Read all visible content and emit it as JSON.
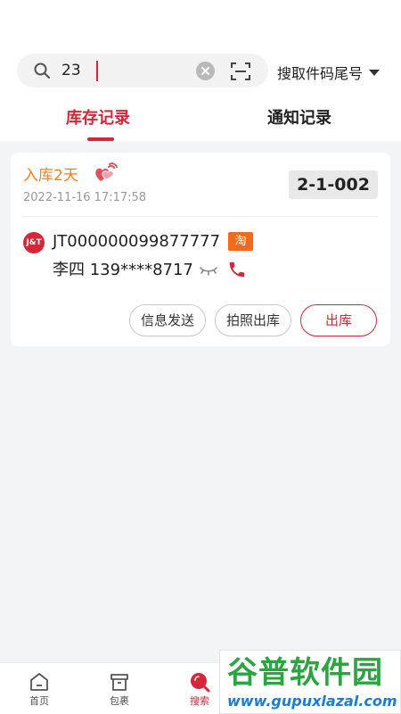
{
  "search": {
    "value": "23",
    "mode_label": "搜取件码尾号"
  },
  "tabs": [
    {
      "label": "库存记录",
      "active": true
    },
    {
      "label": "通知记录",
      "active": false
    }
  ],
  "record": {
    "status": "入库2天",
    "timestamp": "2022-11-16 17:17:58",
    "shelf_code": "2-1-002",
    "carrier_logo": "J&T",
    "tracking_no": "JT000000099877777",
    "platform_badge": "淘",
    "recipient": "李四 139****8717",
    "actions": {
      "send_info": "信息发送",
      "photo_checkout": "拍照出库",
      "checkout": "出库"
    }
  },
  "bottom_nav": [
    {
      "label": "首页",
      "icon": "home-icon"
    },
    {
      "label": "包裹",
      "icon": "parcel-box-icon"
    },
    {
      "label": "搜索",
      "icon": "search-icon",
      "active": true
    }
  ],
  "watermark": {
    "title": "谷普软件园",
    "url": "www.gupuxlazal.com"
  },
  "colors": {
    "accent": "#d6263a",
    "status_orange": "#f3801e",
    "badge_orange": "#f26a1b",
    "page_bg": "#f3f4f6"
  }
}
